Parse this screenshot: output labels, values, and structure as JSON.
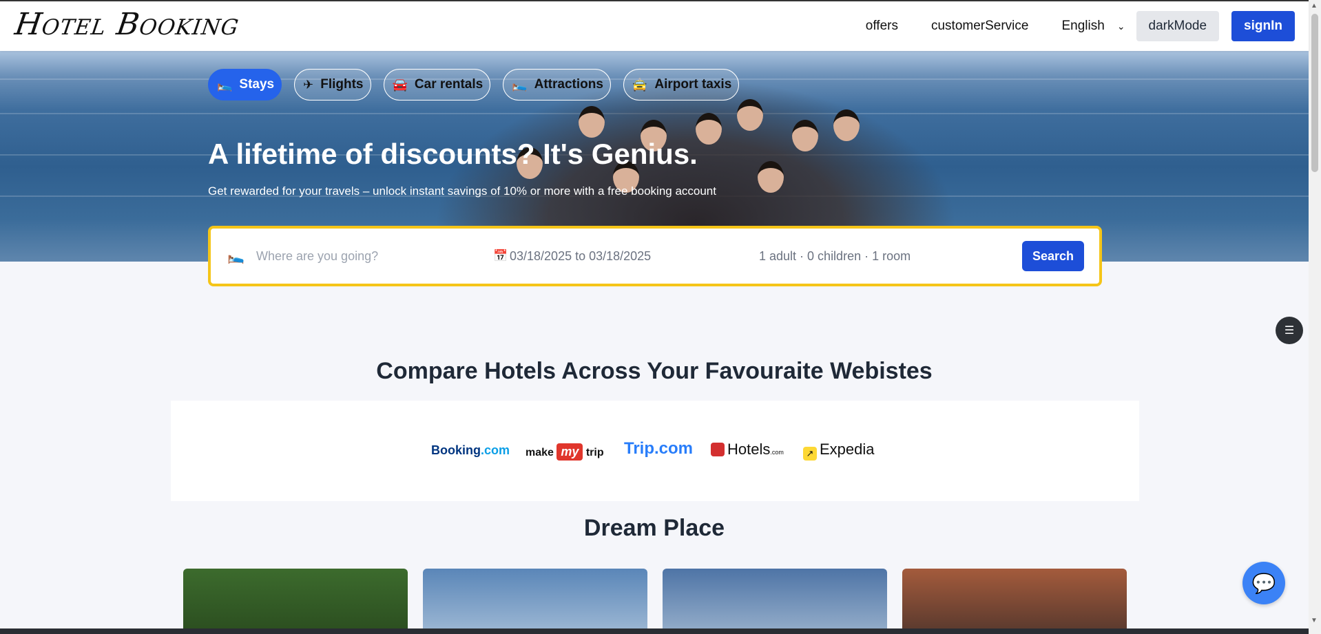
{
  "header": {
    "logo": "Hotel Booking",
    "nav": [
      "offers",
      "customerService"
    ],
    "language": "English",
    "dark_mode_label": "darkMode",
    "signin_label": "signIn"
  },
  "hero": {
    "tabs": [
      {
        "label": "Stays",
        "icon": "bed-icon",
        "active": true
      },
      {
        "label": "Flights",
        "icon": "plane-icon",
        "active": false
      },
      {
        "label": "Car rentals",
        "icon": "car-icon",
        "active": false
      },
      {
        "label": "Attractions",
        "icon": "bed-icon",
        "active": false
      },
      {
        "label": "Airport taxis",
        "icon": "taxi-icon",
        "active": false
      }
    ],
    "title": "A lifetime of discounts? It's Genius.",
    "subtitle": "Get rewarded for your travels – unlock instant savings of 10% or more with a free booking account"
  },
  "search": {
    "destination_placeholder": "Where are you going?",
    "dates": "03/18/2025 to 03/18/2025",
    "guests": "1 adult · 0 children · 1 room",
    "button": "Search"
  },
  "compare": {
    "title": "Compare Hotels Across Your Favouraite Webistes",
    "brands": {
      "booking_a": "Booking",
      "booking_b": ".com",
      "mmt_make": "make",
      "mmt_my": "my",
      "mmt_trip": "trip",
      "trip": "Trip.com",
      "hotels": "Hotels",
      "hotels_com": ".com",
      "expedia": "Expedia"
    }
  },
  "dream": {
    "title": "Dream Place"
  },
  "colors": {
    "primary": "#1d4ed8",
    "accent_border": "#f5c518",
    "active_tab": "#2563eb"
  }
}
